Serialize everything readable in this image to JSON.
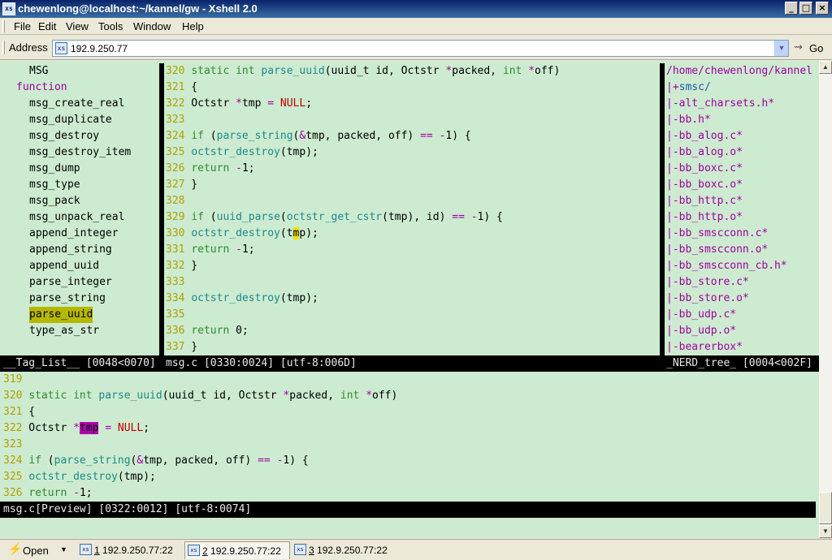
{
  "window": {
    "title": "chewenlong@localhost:~/kannel/gw - Xshell 2.0",
    "app_icon": "xshell-icon",
    "controls": {
      "minimize": "_",
      "maximize": "□",
      "close": "×"
    }
  },
  "menubar": {
    "items": [
      {
        "label": "File",
        "key": "F"
      },
      {
        "label": "Edit",
        "key": "E"
      },
      {
        "label": "View",
        "key": "V"
      },
      {
        "label": "Tools",
        "key": "T"
      },
      {
        "label": "Window",
        "key": "W"
      },
      {
        "label": "Help",
        "key": "H"
      }
    ]
  },
  "addressbar": {
    "label": "Address",
    "value": "192.9.250.77",
    "go_label": "Go"
  },
  "taglist": {
    "header": "MSG",
    "kind": "function",
    "items": [
      "msg_create_real",
      "msg_duplicate",
      "msg_destroy",
      "msg_destroy_item",
      "msg_dump",
      "msg_type",
      "msg_pack",
      "msg_unpack_real",
      "append_integer",
      "append_string",
      "append_uuid",
      "parse_integer",
      "parse_string",
      "parse_uuid",
      "type_as_str"
    ],
    "selected": "parse_uuid",
    "status": "__Tag_List__ [0048<0070]"
  },
  "editor": {
    "status": "msg.c [0330:0024] [utf-8:006D]",
    "lines": {
      "l320": "320",
      "l321": "321",
      "l322": "322",
      "l323": "323",
      "l324": "324",
      "l325": "325",
      "l326": "326",
      "l327": "327",
      "l328": "328",
      "l329": "329",
      "l330": "330",
      "l331": "331",
      "l332": "332",
      "l333": "333",
      "l334": "334",
      "l335": "335",
      "l336": "336",
      "l337": "337"
    }
  },
  "nerdtree": {
    "root": "/home/chewenlong/kannel",
    "dir": "smsc/",
    "files": [
      "alt_charsets.h*",
      "bb.h*",
      "bb_alog.c*",
      "bb_alog.o*",
      "bb_boxc.c*",
      "bb_boxc.o*",
      "bb_http.c*",
      "bb_http.o*",
      "bb_smscconn.c*",
      "bb_smscconn.o*",
      "bb_smscconn_cb.h*",
      "bb_store.c*",
      "bb_store.o*",
      "bb_udp.c*",
      "bb_udp.o*",
      "bearerbox*"
    ],
    "status": "_NERD_tree_ [0004<002F]"
  },
  "preview": {
    "lines": {
      "l319": "319",
      "l320": "320",
      "l321": "321",
      "l322": "322",
      "l323": "323",
      "l324": "324",
      "l325": "325",
      "l326": "326"
    },
    "status": "msg.c[Preview] [0322:0012] [utf-8:0074]"
  },
  "tabbar": {
    "open_label": "Open",
    "tabs": [
      {
        "num": "1",
        "label": " 192.9.250.77:22"
      },
      {
        "num": "2",
        "label": " 192.9.250.77:22"
      },
      {
        "num": "3",
        "label": " 192.9.250.77:22"
      }
    ],
    "active_tab": "2"
  }
}
